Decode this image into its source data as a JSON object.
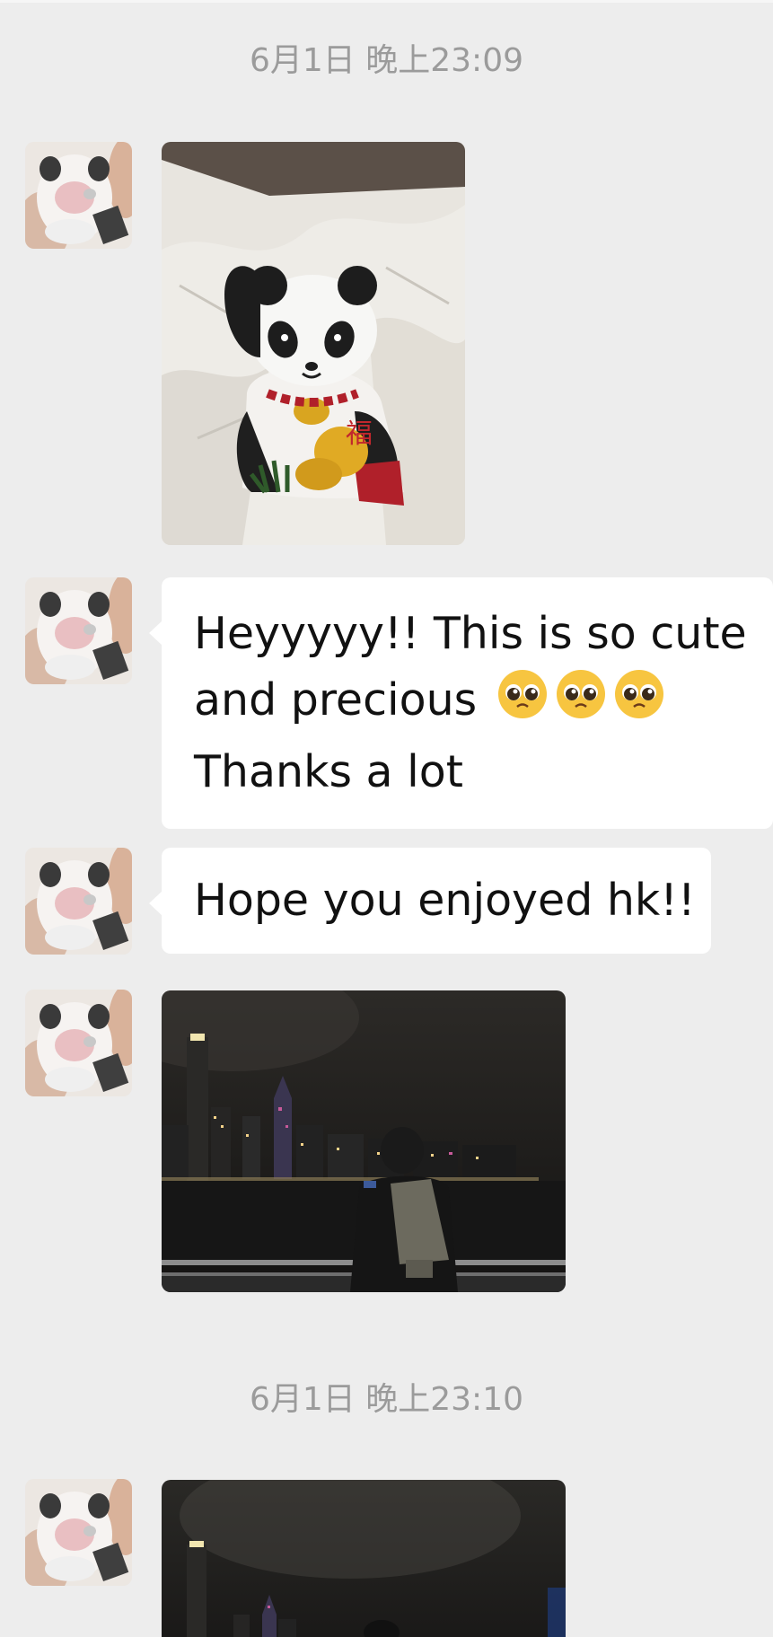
{
  "chat": {
    "timestamps": [
      "6月1日 晚上23:09",
      "6月1日 晚上23:10"
    ],
    "messages": {
      "text1": {
        "line1": "Heyyyyy!! This is so cute",
        "line2_text": "and precious",
        "line3": "Thanks a lot",
        "emoji_icon": "pleading-face-emoji",
        "emoji_count": 3
      },
      "text2": "Hope you enjoyed hk!!"
    },
    "avatar_icon": "panda-cat-avatar",
    "images": [
      "panda-lucky-cat-photo",
      "hong-kong-harbour-night-photo",
      "hong-kong-harbour-night-photo-2"
    ]
  },
  "colors": {
    "background": "#ededed",
    "bubble": "#ffffff",
    "timestamp": "#9b9b9b"
  }
}
